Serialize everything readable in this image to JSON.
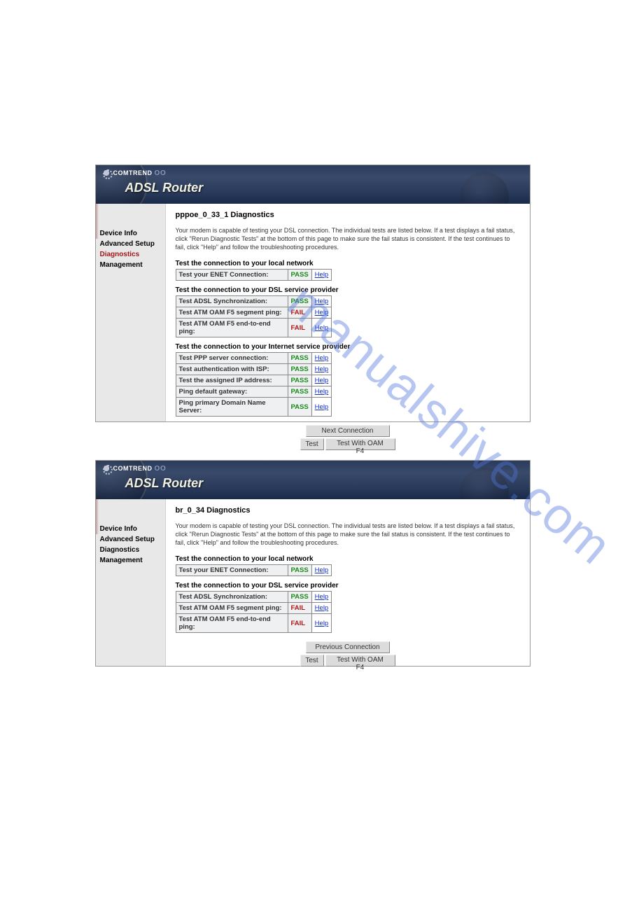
{
  "watermark": "manualshive.com",
  "brand": {
    "logo_text": "COMTREND",
    "logo_suffix": "O O",
    "title": "ADSL Router"
  },
  "nav": {
    "items": [
      {
        "label": "Device Info",
        "active": false
      },
      {
        "label": "Advanced Setup",
        "active": false
      },
      {
        "label": "Diagnostics",
        "active": true
      },
      {
        "label": "Management",
        "active": false
      }
    ]
  },
  "nav2": {
    "items": [
      {
        "label": "Device Info",
        "active": false
      },
      {
        "label": "Advanced Setup",
        "active": false
      },
      {
        "label": "Diagnostics",
        "active": false
      },
      {
        "label": "Management",
        "active": false
      }
    ]
  },
  "help_label": "Help",
  "intro_text": "Your modem is capable of testing your DSL connection. The individual tests are listed below. If a test displays a fail status, click \"Rerun Diagnostic Tests\" at the bottom of this page to make sure the fail status is consistent. If the test continues to fail, click \"Help\" and follow the troubleshooting procedures.",
  "section_labels": {
    "local": "Test the connection to your local network",
    "dsl": "Test the connection to your DSL service provider",
    "isp": "Test the connection to your Internet service provider"
  },
  "panel1": {
    "title": "pppoe_0_33_1 Diagnostics",
    "local": [
      {
        "label": "Test your ENET Connection:",
        "status": "PASS"
      }
    ],
    "dsl": [
      {
        "label": "Test ADSL Synchronization:",
        "status": "PASS"
      },
      {
        "label": "Test ATM OAM F5 segment ping:",
        "status": "FAIL"
      },
      {
        "label": "Test ATM OAM F5 end-to-end ping:",
        "status": "FAIL"
      }
    ],
    "isp": [
      {
        "label": "Test PPP server connection:",
        "status": "PASS"
      },
      {
        "label": "Test authentication with ISP:",
        "status": "PASS"
      },
      {
        "label": "Test the assigned IP address:",
        "status": "PASS"
      },
      {
        "label": "Ping default gateway:",
        "status": "PASS"
      },
      {
        "label": "Ping primary Domain Name Server:",
        "status": "PASS"
      }
    ],
    "buttons": {
      "next": "Next Connection",
      "test": "Test",
      "test_f4": "Test With OAM F4"
    }
  },
  "panel2": {
    "title": "br_0_34 Diagnostics",
    "local": [
      {
        "label": "Test your ENET Connection:",
        "status": "PASS"
      }
    ],
    "dsl": [
      {
        "label": "Test ADSL Synchronization:",
        "status": "PASS"
      },
      {
        "label": "Test ATM OAM F5 segment ping:",
        "status": "FAIL"
      },
      {
        "label": "Test ATM OAM F5 end-to-end ping:",
        "status": "FAIL"
      }
    ],
    "buttons": {
      "prev": "Previous Connection",
      "test": "Test",
      "test_f4": "Test With OAM F4"
    }
  }
}
